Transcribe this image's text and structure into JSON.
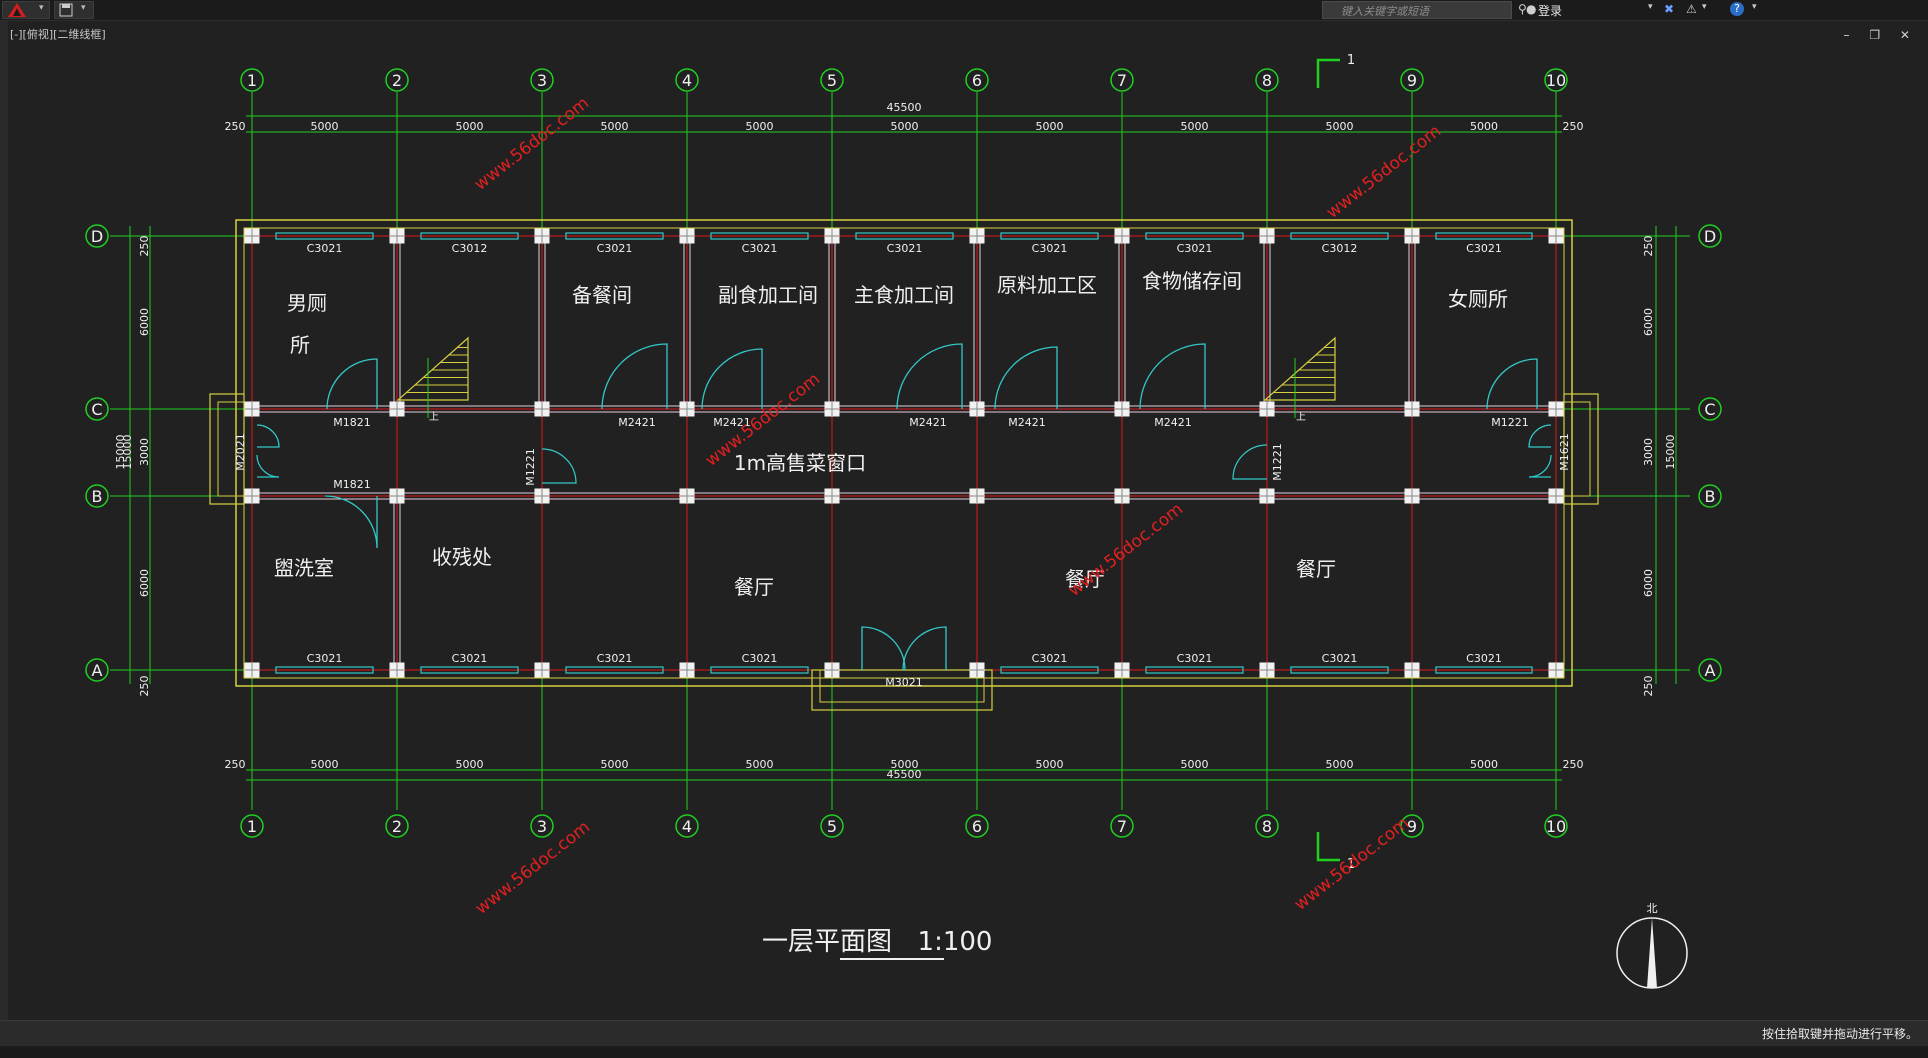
{
  "app": {
    "search_placeholder": "键入关键字或短语",
    "login_label": "登录",
    "viewport_label": "[-][俯视][二维线框]",
    "status_text": "按住拾取键并拖动进行平移。",
    "window_controls": "– ❐ ✕"
  },
  "drawing": {
    "title": "一层平面图",
    "scale": "1:100",
    "north_label": "北",
    "section_label": "1",
    "axes_numbered": [
      "1",
      "2",
      "3",
      "4",
      "5",
      "6",
      "7",
      "8",
      "9",
      "10"
    ],
    "axes_lettered": [
      "D",
      "C",
      "B",
      "A"
    ],
    "dims": {
      "total": "45500",
      "bay": "5000",
      "edge": "250",
      "depth_a": "6000",
      "depth_b": "3000",
      "overall_depth": "15000",
      "overall_depth_overlap": "15000"
    },
    "windows_top": [
      "C3021",
      "C3012",
      "C3021",
      "C3021",
      "C3021",
      "C3021",
      "C3021",
      "C3012",
      "C3021"
    ],
    "windows_bottom": [
      "C3021",
      "C3021",
      "C3021",
      "C3021",
      "C3021",
      "C3021",
      "C3021",
      "C3021"
    ],
    "doors_c_line": [
      "M1821",
      "M2421",
      "M2421",
      "M2421",
      "M2421",
      "M2421",
      "M1221"
    ],
    "door_b_line": "M1821",
    "door_side_left": "M2021",
    "door_side_right": "M1621",
    "door_corridor_left": "M1221",
    "door_corridor_right": "M1221",
    "door_main": "M3021",
    "rooms": [
      "男厕",
      "所",
      "备餐间",
      "副食加工间",
      "主食加工间",
      "原料加工区",
      "食物储存间",
      "女厕所",
      "1m高售菜窗口",
      "盥洗室",
      "收残处",
      "餐厅",
      "餐厅",
      "餐厅"
    ],
    "stair_label": "上",
    "watermark": "www.56doc.com"
  },
  "colors": {
    "background": "#212121",
    "grid_green": "#20d020",
    "red_line": "#e01818",
    "wall_yellow": "#d7cf40",
    "window_cyan": "#33c8c8",
    "watermark_red": "#e02020",
    "text_white": "#f0f0f0"
  }
}
